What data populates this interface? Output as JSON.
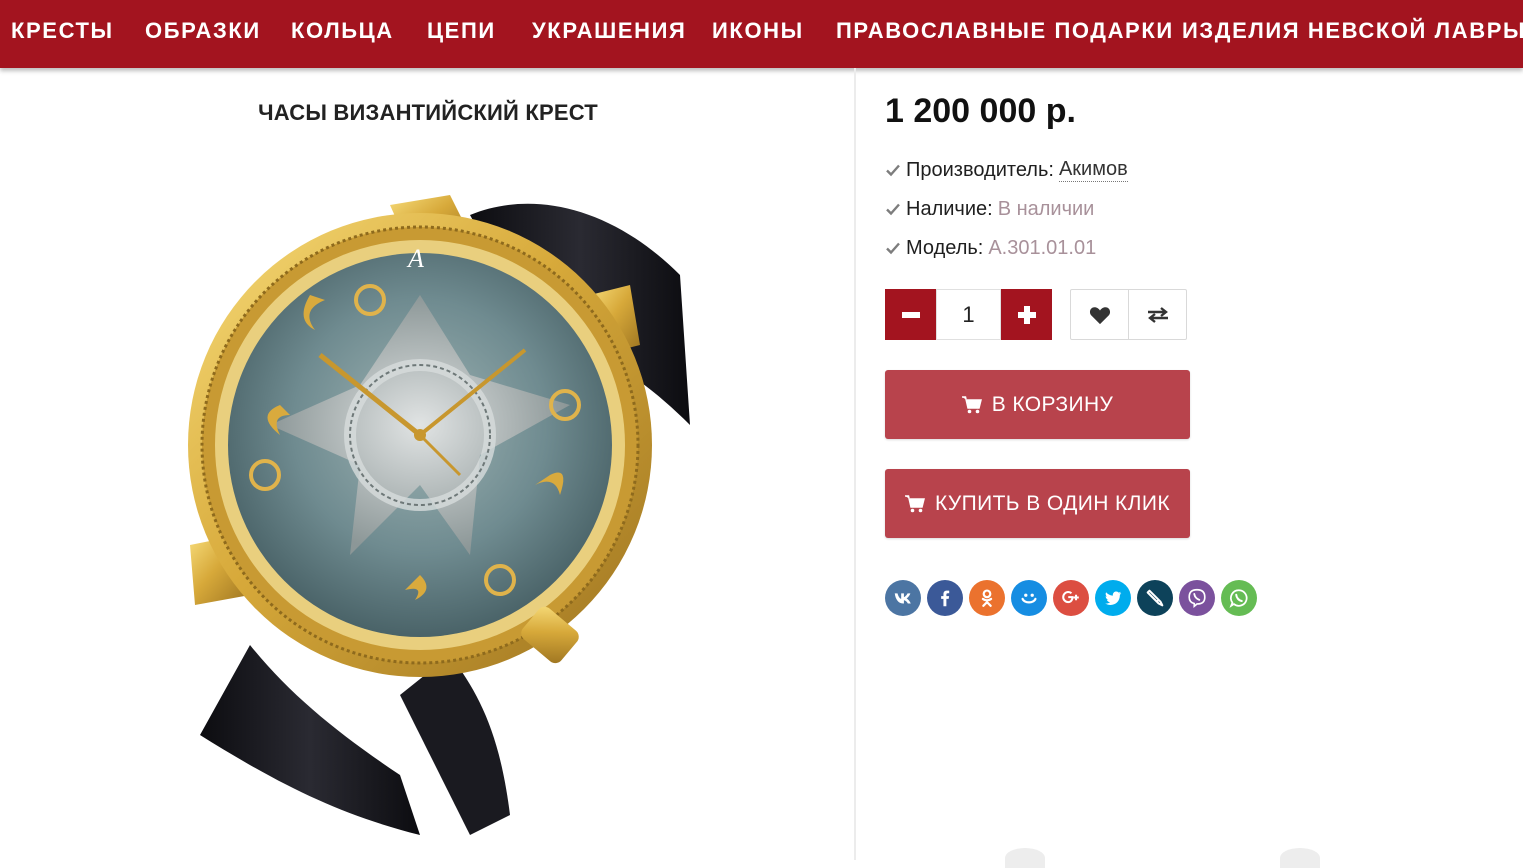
{
  "nav": {
    "items": [
      "КРЕСТЫ",
      "ОБРАЗКИ",
      "КОЛЬЦА",
      "ЦЕПИ",
      "УКРАШЕНИЯ",
      "ИКОНЫ",
      "ПРАВОСЛАВНЫЕ ПОДАРКИ",
      "ИЗДЕЛИЯ НЕВСКОЙ ЛАВРЫ"
    ]
  },
  "product": {
    "title": "ЧАСЫ ВИЗАНТИЙСКИЙ КРЕСТ",
    "price": "1 200 000 р.",
    "attributes": [
      {
        "label": "Производитель:",
        "value": "Акимов",
        "style": "link"
      },
      {
        "label": "Наличие:",
        "value": "В наличии",
        "style": "muted"
      },
      {
        "label": "Модель:",
        "value": "A.301.01.01",
        "style": "muted"
      }
    ]
  },
  "purchase": {
    "quantity": "1",
    "cart_label": "В КОРЗИНУ",
    "one_click_label": "КУПИТЬ В ОДИН КЛИК"
  },
  "share": {
    "networks": [
      {
        "name": "vk-icon",
        "color": "#4c75a3"
      },
      {
        "name": "facebook-icon",
        "color": "#3b5998"
      },
      {
        "name": "odnoklassniki-icon",
        "color": "#eb722e"
      },
      {
        "name": "moimir-icon",
        "color": "#168de2"
      },
      {
        "name": "googleplus-icon",
        "color": "#dc4e41"
      },
      {
        "name": "twitter-icon",
        "color": "#00aced"
      },
      {
        "name": "livejournal-icon",
        "color": "#0d425a"
      },
      {
        "name": "viber-icon",
        "color": "#7b519d"
      },
      {
        "name": "whatsapp-icon",
        "color": "#65bc54"
      }
    ]
  },
  "colors": {
    "brand": "#a3141f",
    "button": "#b8434c",
    "muted_value": "#a8919a"
  }
}
